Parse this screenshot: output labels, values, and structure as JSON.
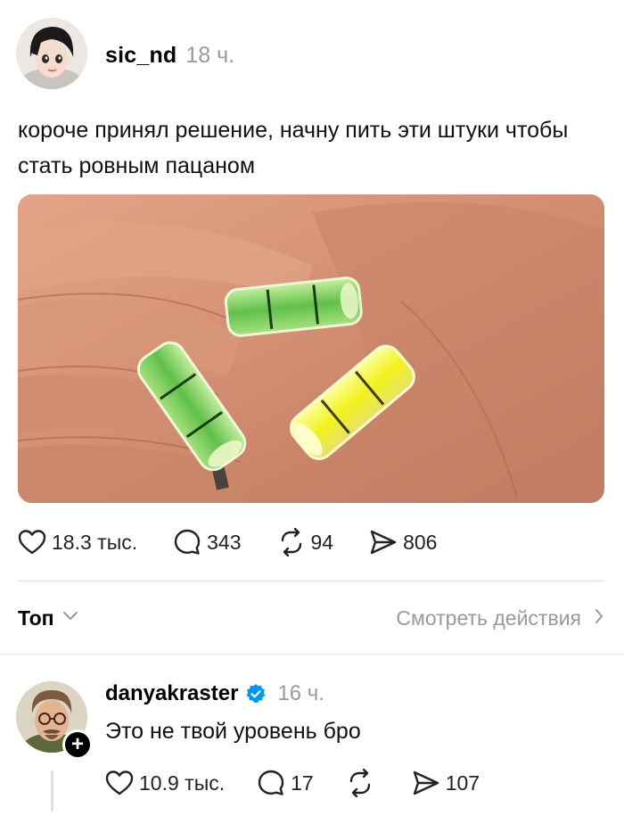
{
  "post": {
    "author": {
      "username": "sic_nd",
      "time": "18 ч."
    },
    "text": "короче принял решение, начну пить эти штуки чтобы стать ровным пацаном",
    "actions": {
      "likes": "18.3 тыс.",
      "comments": "343",
      "reposts": "94",
      "shares": "806"
    }
  },
  "sort_bar": {
    "label": "Топ",
    "view_activity": "Смотреть действия"
  },
  "reply": {
    "author": {
      "username": "danyakraster",
      "time": "16 ч.",
      "verified": true
    },
    "text": "Это не твой уровень бро",
    "actions": {
      "likes": "10.9 тыс.",
      "comments": "17",
      "reposts": "",
      "shares": "107"
    },
    "follow_badge": "+"
  },
  "colors": {
    "muted": "#9a9a9a",
    "verified_blue": "#0095f6"
  }
}
